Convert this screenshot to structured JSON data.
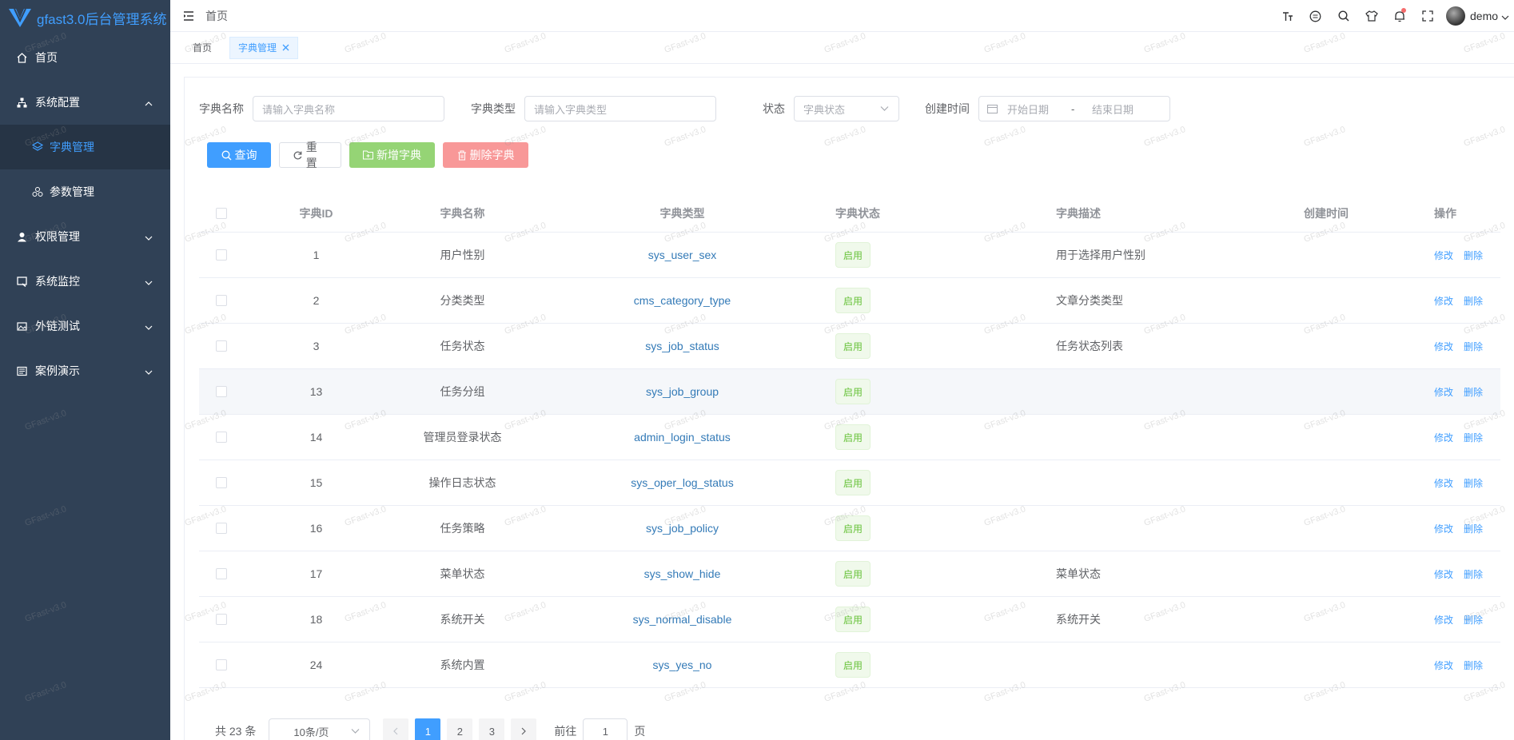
{
  "app": {
    "title": "gfast3.0后台管理系统"
  },
  "sidebar": {
    "items": [
      {
        "label": "首页",
        "icon": "home-icon"
      },
      {
        "label": "系统配置",
        "icon": "sitemap-icon",
        "expanded": true,
        "children": [
          {
            "label": "字典管理",
            "icon": "layers-icon",
            "active": true
          },
          {
            "label": "参数管理",
            "icon": "nodes-icon"
          }
        ]
      },
      {
        "label": "权限管理",
        "icon": "user-icon"
      },
      {
        "label": "系统监控",
        "icon": "monitor-icon"
      },
      {
        "label": "外链测试",
        "icon": "image-icon"
      },
      {
        "label": "案例演示",
        "icon": "book-icon"
      }
    ]
  },
  "header": {
    "breadcrumb": "首页",
    "icons": [
      "font-size-icon",
      "message-icon",
      "search-icon",
      "theme-shirt-icon",
      "bell-icon",
      "fullscreen-icon"
    ],
    "username": "demo"
  },
  "tabs": [
    {
      "label": "首页",
      "active": false
    },
    {
      "label": "字典管理",
      "active": true
    }
  ],
  "filters": {
    "dict_name": {
      "label": "字典名称",
      "placeholder": "请输入字典名称"
    },
    "dict_type": {
      "label": "字典类型",
      "placeholder": "请输入字典类型"
    },
    "status": {
      "label": "状态",
      "placeholder": "字典状态"
    },
    "created": {
      "label": "创建时间",
      "start_placeholder": "开始日期",
      "separator": "-",
      "end_placeholder": "结束日期"
    }
  },
  "buttons": {
    "query": "查询",
    "reset": "重置",
    "add": "新增字典",
    "delete": "删除字典"
  },
  "table": {
    "columns": [
      "字典ID",
      "字典名称",
      "字典类型",
      "字典状态",
      "字典描述",
      "创建时间",
      "操作"
    ],
    "edit_label": "修改",
    "delete_label": "删除",
    "rows": [
      {
        "id": "1",
        "name": "用户性别",
        "type": "sys_user_sex",
        "status": "启用",
        "desc": "用于选择用户性别",
        "created": ""
      },
      {
        "id": "2",
        "name": "分类类型",
        "type": "cms_category_type",
        "status": "启用",
        "desc": "文章分类类型",
        "created": ""
      },
      {
        "id": "3",
        "name": "任务状态",
        "type": "sys_job_status",
        "status": "启用",
        "desc": "任务状态列表",
        "created": ""
      },
      {
        "id": "13",
        "name": "任务分组",
        "type": "sys_job_group",
        "status": "启用",
        "desc": "",
        "created": ""
      },
      {
        "id": "14",
        "name": "管理员登录状态",
        "type": "admin_login_status",
        "status": "启用",
        "desc": "",
        "created": ""
      },
      {
        "id": "15",
        "name": "操作日志状态",
        "type": "sys_oper_log_status",
        "status": "启用",
        "desc": "",
        "created": ""
      },
      {
        "id": "16",
        "name": "任务策略",
        "type": "sys_job_policy",
        "status": "启用",
        "desc": "",
        "created": ""
      },
      {
        "id": "17",
        "name": "菜单状态",
        "type": "sys_show_hide",
        "status": "启用",
        "desc": "菜单状态",
        "created": ""
      },
      {
        "id": "18",
        "name": "系统开关",
        "type": "sys_normal_disable",
        "status": "启用",
        "desc": "系统开关",
        "created": ""
      },
      {
        "id": "24",
        "name": "系统内置",
        "type": "sys_yes_no",
        "status": "启用",
        "desc": "",
        "created": ""
      }
    ]
  },
  "pagination": {
    "total": "共 23 条",
    "page_size": "10条/页",
    "pages": [
      "1",
      "2",
      "3"
    ],
    "current": "1",
    "goto_label": "前往",
    "goto_value": "1",
    "page_unit": "页"
  },
  "watermark": "GFast-v3.0",
  "colors": {
    "sidebar_bg": "#304156",
    "primary": "#409eff",
    "success": "#95d475",
    "danger": "#f89898",
    "tag_green": "#67c23a"
  }
}
